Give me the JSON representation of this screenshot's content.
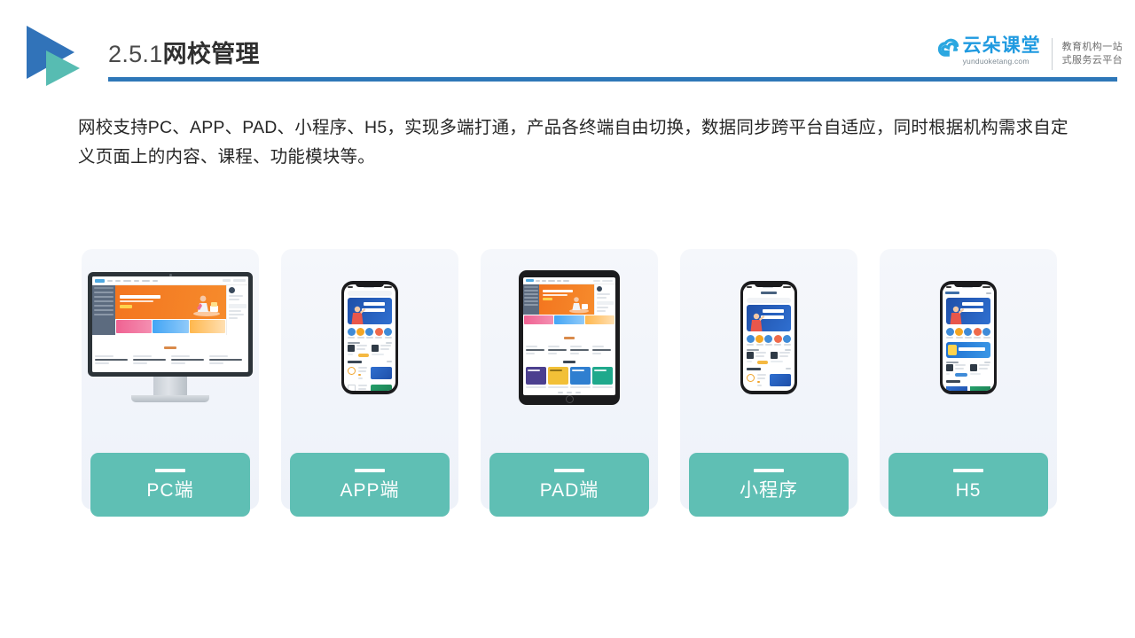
{
  "header": {
    "title_number": "2.5.1",
    "title_cn": "网校管理",
    "logo_icon": "double-triangle-play-icon",
    "rule_color": "#2e77b8"
  },
  "brand": {
    "cloud_icon": "cloud-icon",
    "name_cn": "云朵课堂",
    "url": "yunduoketang.com",
    "tagline_line1": "教育机构一站",
    "tagline_line2": "式服务云平台",
    "brand_color": "#1f9ae0"
  },
  "lead": {
    "paragraph": "网校支持PC、APP、PAD、小程序、H5，实现多端打通，产品各终端自由切换，数据同步跨平台自适应，同时根据机构需求自定义页面上的内容、课程、功能模块等。"
  },
  "cards": {
    "accent_color": "#5fbfb4",
    "panel_color": "#f2f5fa",
    "items": [
      {
        "label": "PC端",
        "device": "desktop-monitor-icon"
      },
      {
        "label": "APP端",
        "device": "mobile-phone-icon"
      },
      {
        "label": "PAD端",
        "device": "tablet-icon"
      },
      {
        "label": "小程序",
        "device": "mobile-phone-icon"
      },
      {
        "label": "H5",
        "device": "mobile-phone-icon"
      }
    ]
  }
}
